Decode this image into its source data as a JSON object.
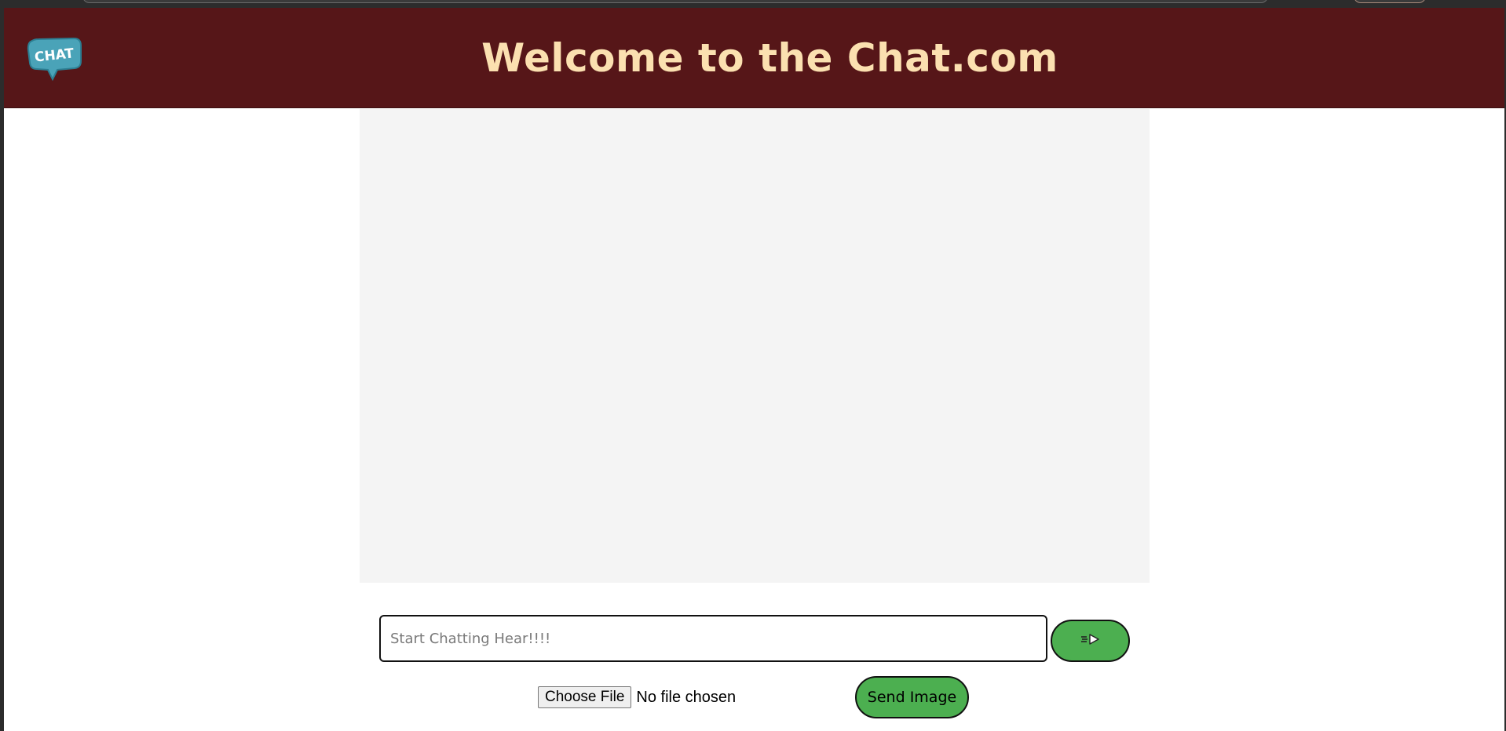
{
  "header": {
    "title": "Welcome to the Chat.com",
    "logo_text": "CHAT",
    "background": "#561618",
    "title_color": "#fbe0b0"
  },
  "chat": {
    "input_placeholder": "Start Chatting Hear!!!!",
    "input_value": "",
    "send_icon": "send-arrow-icon"
  },
  "file_upload": {
    "choose_label": "Choose File",
    "status": "No file chosen",
    "send_image_label": "Send Image"
  },
  "colors": {
    "button_green": "#4caf50",
    "chat_area": "#f4f4f4",
    "logo_teal": "#4aa3b8"
  }
}
